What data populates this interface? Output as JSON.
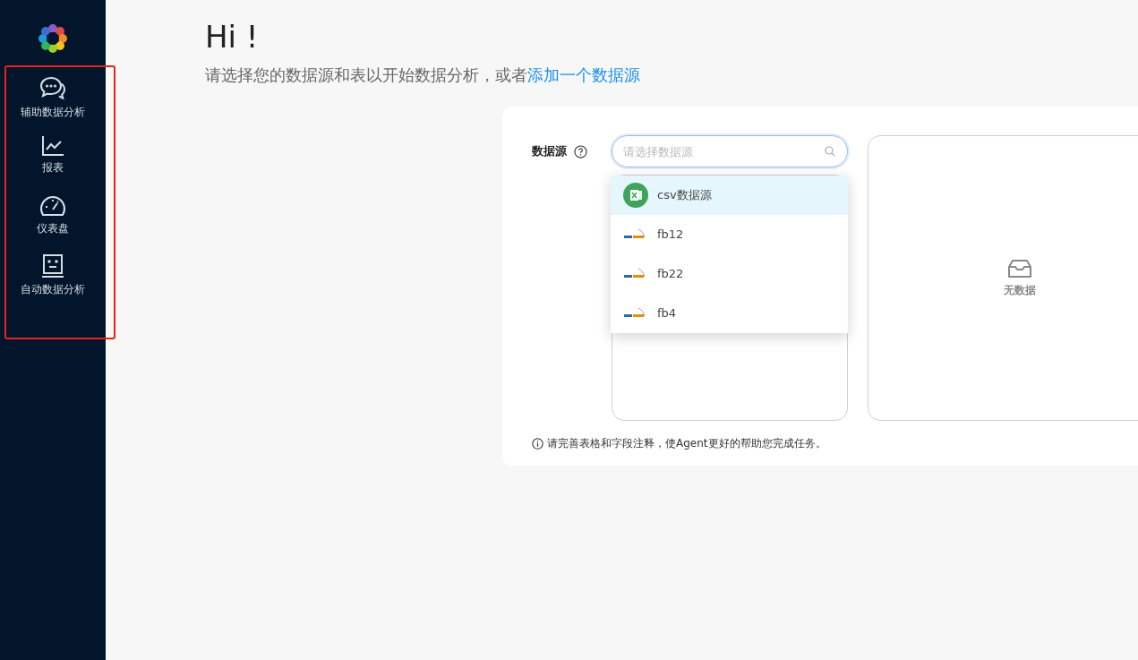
{
  "sidebar": {
    "highlighted": true,
    "items": [
      {
        "label": "辅助数据分析",
        "kind": "chat"
      },
      {
        "label": "报表",
        "kind": "chart"
      },
      {
        "label": "仪表盘",
        "kind": "gauge"
      },
      {
        "label": "自动数据分析",
        "kind": "robot"
      }
    ]
  },
  "header": {
    "title": "Hi !",
    "subtitle": "请选择您的数据源和表以开始数据分析，或者",
    "link": "添加一个数据源"
  },
  "datasource": {
    "label": "数据源",
    "placeholder": "请选择数据源",
    "options": [
      {
        "label": "csv数据源",
        "kind": "csv",
        "selected": true
      },
      {
        "label": "fb12",
        "kind": "mysql",
        "selected": false
      },
      {
        "label": "fb22",
        "kind": "mysql",
        "selected": false
      },
      {
        "label": "fb4",
        "kind": "mysql",
        "selected": false
      }
    ]
  },
  "table_panel": {
    "empty_text": "无数据"
  },
  "note": "请完善表格和字段注释，使Agent更好的帮助您完成任务。"
}
